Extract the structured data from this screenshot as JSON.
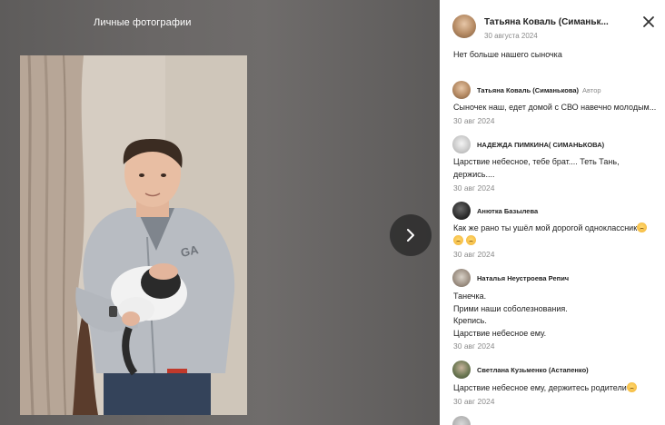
{
  "viewer": {
    "album_title": "Личные фотографии"
  },
  "post": {
    "author": "Татьяна Коваль (Симаньк...",
    "date": "30 августа 2024",
    "text": "Нет больше нашего сыночка"
  },
  "comments": [
    {
      "author": "Татьяна Коваль (Симанькова)",
      "badge": "Автор",
      "lines": [
        "Сыночек наш, едет домой с СВО навечно молодым..."
      ],
      "date": "30 авг 2024"
    },
    {
      "author": "НАДЕЖДА ПИМКИНА( СИМАНЬКОВА)",
      "lines": [
        "Царствие небесное, тебе брат.... Теть Тань,",
        "держись...."
      ],
      "date": "30 авг 2024"
    },
    {
      "author": "Анютка Базылева",
      "lines": [
        "Как же рано ты ушёл мой дорогой одноклассник"
      ],
      "date": "30 авг 2024"
    },
    {
      "author": "Наталья Неустроева Репич",
      "lines": [
        "Танечка.",
        "Прими наши соболезнования.",
        "Крепись.",
        "Царствие небесное ему."
      ],
      "date": "30 авг 2024"
    },
    {
      "author": "Светлана Кузьменко (Астапенко)",
      "lines": [
        "Царствие небесное ему, держитесь родители"
      ],
      "date": "30 авг 2024"
    }
  ],
  "icons": {
    "next": "chevron-right-icon",
    "close": "close-icon",
    "emoji": "crying-face-emoji-icon"
  }
}
